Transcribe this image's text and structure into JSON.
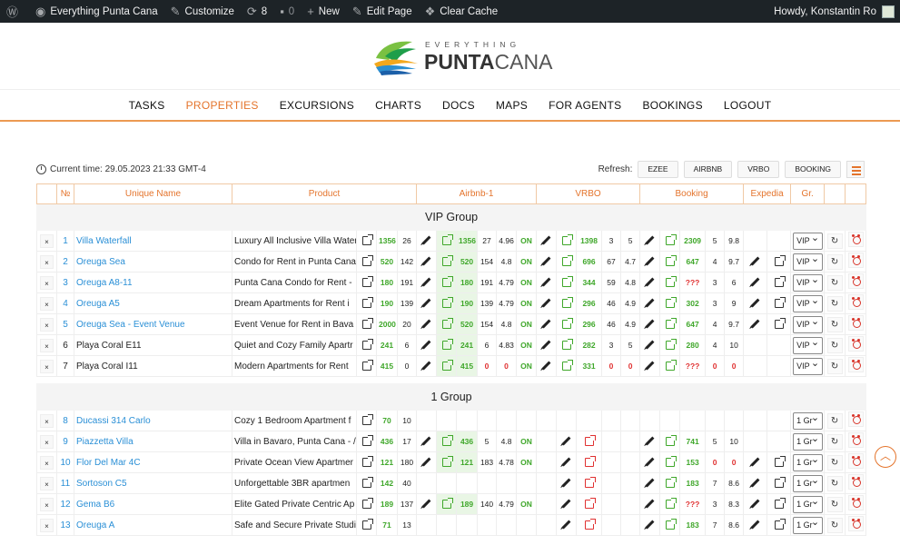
{
  "adminbar": {
    "site": "Everything Punta Cana",
    "customize": "Customize",
    "updates": "8",
    "comments": "0",
    "new": "New",
    "edit": "Edit Page",
    "cache": "Clear Cache",
    "howdy": "Howdy, Konstantin Ro"
  },
  "logo": {
    "line1": "EVERYTHING",
    "line2a": "PUNTA",
    "line2b": "CANA"
  },
  "nav": [
    "TASKS",
    "PROPERTIES",
    "EXCURSIONS",
    "CHARTS",
    "DOCS",
    "MAPS",
    "FOR AGENTS",
    "BOOKINGS",
    "LOGOUT"
  ],
  "toolbar": {
    "time": "Current time: 29.05.2023 21:33 GMT-4",
    "refresh": "Refresh:",
    "buttons": [
      "EZEE",
      "AIRBNB",
      "VRBO",
      "BOOKING"
    ]
  },
  "headers": [
    "№",
    "Unique Name",
    "Product",
    "Airbnb-1",
    "VRBO",
    "Booking",
    "Expedia",
    "Gr."
  ],
  "colors": {
    "accent": "#e4742c",
    "link": "#2a8fd6",
    "green": "#3fa72a",
    "red": "#e03131"
  },
  "groups": [
    {
      "title": "VIP Group",
      "rows": [
        {
          "n": "1",
          "name": "Villa Waterfall",
          "link": true,
          "product": "Luxury All Inclusive Villa Water",
          "ezee": "1356",
          "ez2": "26",
          "a1": "1356",
          "a2": "27",
          "a3": "4.96",
          "a4": "ON",
          "v1": "1398",
          "v2": "3",
          "v3": "5",
          "b1": "2309",
          "b2": "5",
          "b3": "9.8",
          "exp": false,
          "gr": "VIP"
        },
        {
          "n": "2",
          "name": "Oreuga Sea",
          "link": true,
          "product": "Condo for Rent in Punta Cana",
          "ezee": "520",
          "ez2": "142",
          "a1": "520",
          "a2": "154",
          "a3": "4.8",
          "a4": "ON",
          "v1": "696",
          "v2": "67",
          "v3": "4.7",
          "b1": "647",
          "b2": "4",
          "b3": "9.7",
          "exp": true,
          "gr": "VIP"
        },
        {
          "n": "3",
          "name": "Oreuga A8-11",
          "link": true,
          "product": "Punta Cana Condo for Rent -",
          "ezee": "180",
          "ez2": "191",
          "a1": "180",
          "a2": "191",
          "a3": "4.79",
          "a4": "ON",
          "v1": "344",
          "v2": "59",
          "v3": "4.8",
          "b1": "???",
          "b2": "3",
          "b3": "6",
          "exp": true,
          "gr": "VIP"
        },
        {
          "n": "4",
          "name": "Oreuga A5",
          "link": true,
          "product": "Dream Apartments for Rent i",
          "ezee": "190",
          "ez2": "139",
          "a1": "190",
          "a2": "139",
          "a3": "4.79",
          "a4": "ON",
          "v1": "296",
          "v2": "46",
          "v3": "4.9",
          "b1": "302",
          "b2": "3",
          "b3": "9",
          "exp": true,
          "gr": "VIP"
        },
        {
          "n": "5",
          "name": "Oreuga Sea - Event Venue",
          "link": true,
          "product": "Event Venue for Rent in Bava",
          "ezee": "2000",
          "ez2": "20",
          "a1": "520",
          "a2": "154",
          "a3": "4.8",
          "a4": "ON",
          "v1": "296",
          "v2": "46",
          "v3": "4.9",
          "b1": "647",
          "b2": "4",
          "b3": "9.7",
          "exp": true,
          "gr": "VIP"
        },
        {
          "n": "6",
          "name": "Playa Coral E11",
          "link": false,
          "product": "Quiet and Cozy Family Apartr",
          "ezee": "241",
          "ez2": "6",
          "a1": "241",
          "a2": "6",
          "a3": "4.83",
          "a4": "ON",
          "v1": "282",
          "v2": "3",
          "v3": "5",
          "b1": "280",
          "b2": "4",
          "b3": "10",
          "exp": false,
          "gr": "VIP"
        },
        {
          "n": "7",
          "name": "Playa Coral I11",
          "link": false,
          "product": "Modern Apartments for Rent",
          "ezee": "415",
          "ez2": "0",
          "a1": "415",
          "a2": "0",
          "a3": "0",
          "a4": "ON",
          "v1": "331",
          "v2": "0",
          "v3": "0",
          "b1": "???",
          "b2": "0",
          "b3": "0",
          "exp": false,
          "gr": "VIP"
        }
      ]
    },
    {
      "title": "1 Group",
      "rows": [
        {
          "n": "8",
          "name": "Ducassi 314 Carlo",
          "link": true,
          "product": "Cozy 1 Bedroom Apartment f",
          "ezee": "70",
          "ez2": "10",
          "air": false,
          "vrbo": false,
          "book": false,
          "exp": false,
          "gr": "1 Gr"
        },
        {
          "n": "9",
          "name": "Piazzetta Villa",
          "link": true,
          "product": "Villa in Bavaro, Punta Cana - /",
          "ezee": "436",
          "ez2": "17",
          "a1": "436",
          "a2": "5",
          "a3": "4.8",
          "a4": "ON",
          "vr": true,
          "b1": "741",
          "b2": "5",
          "b3": "10",
          "exp": false,
          "gr": "1 Gr"
        },
        {
          "n": "10",
          "name": "Flor Del Mar 4C",
          "link": true,
          "product": "Private Ocean View Apartmer",
          "ezee": "121",
          "ez2": "180",
          "a1": "121",
          "a2": "183",
          "a3": "4.78",
          "a4": "ON",
          "vr": true,
          "b1": "153",
          "b2": "0",
          "b3": "0",
          "exp": true,
          "gr": "1 Gr"
        },
        {
          "n": "11",
          "name": "Sortoson C5",
          "link": true,
          "product": "Unforgettable 3BR apartmen",
          "ezee": "142",
          "ez2": "40",
          "air": false,
          "vr": true,
          "b1": "183",
          "b2": "7",
          "b3": "8.6",
          "exp": true,
          "gr": "1 Gr"
        },
        {
          "n": "12",
          "name": "Gema B6",
          "link": true,
          "product": "Elite Gated Private Centric Ap",
          "ezee": "189",
          "ez2": "137",
          "a1": "189",
          "a2": "140",
          "a3": "4.79",
          "a4": "ON",
          "vr": true,
          "b1": "???",
          "b2": "3",
          "b3": "8.3",
          "exp": true,
          "gr": "1 Gr"
        },
        {
          "n": "13",
          "name": "Oreuga A",
          "link": true,
          "product": "Safe and Secure Private Studi",
          "ezee": "71",
          "ez2": "13",
          "air": false,
          "vr": true,
          "b1": "183",
          "b2": "7",
          "b3": "8.6",
          "exp": true,
          "gr": "1 Gr"
        }
      ]
    }
  ]
}
